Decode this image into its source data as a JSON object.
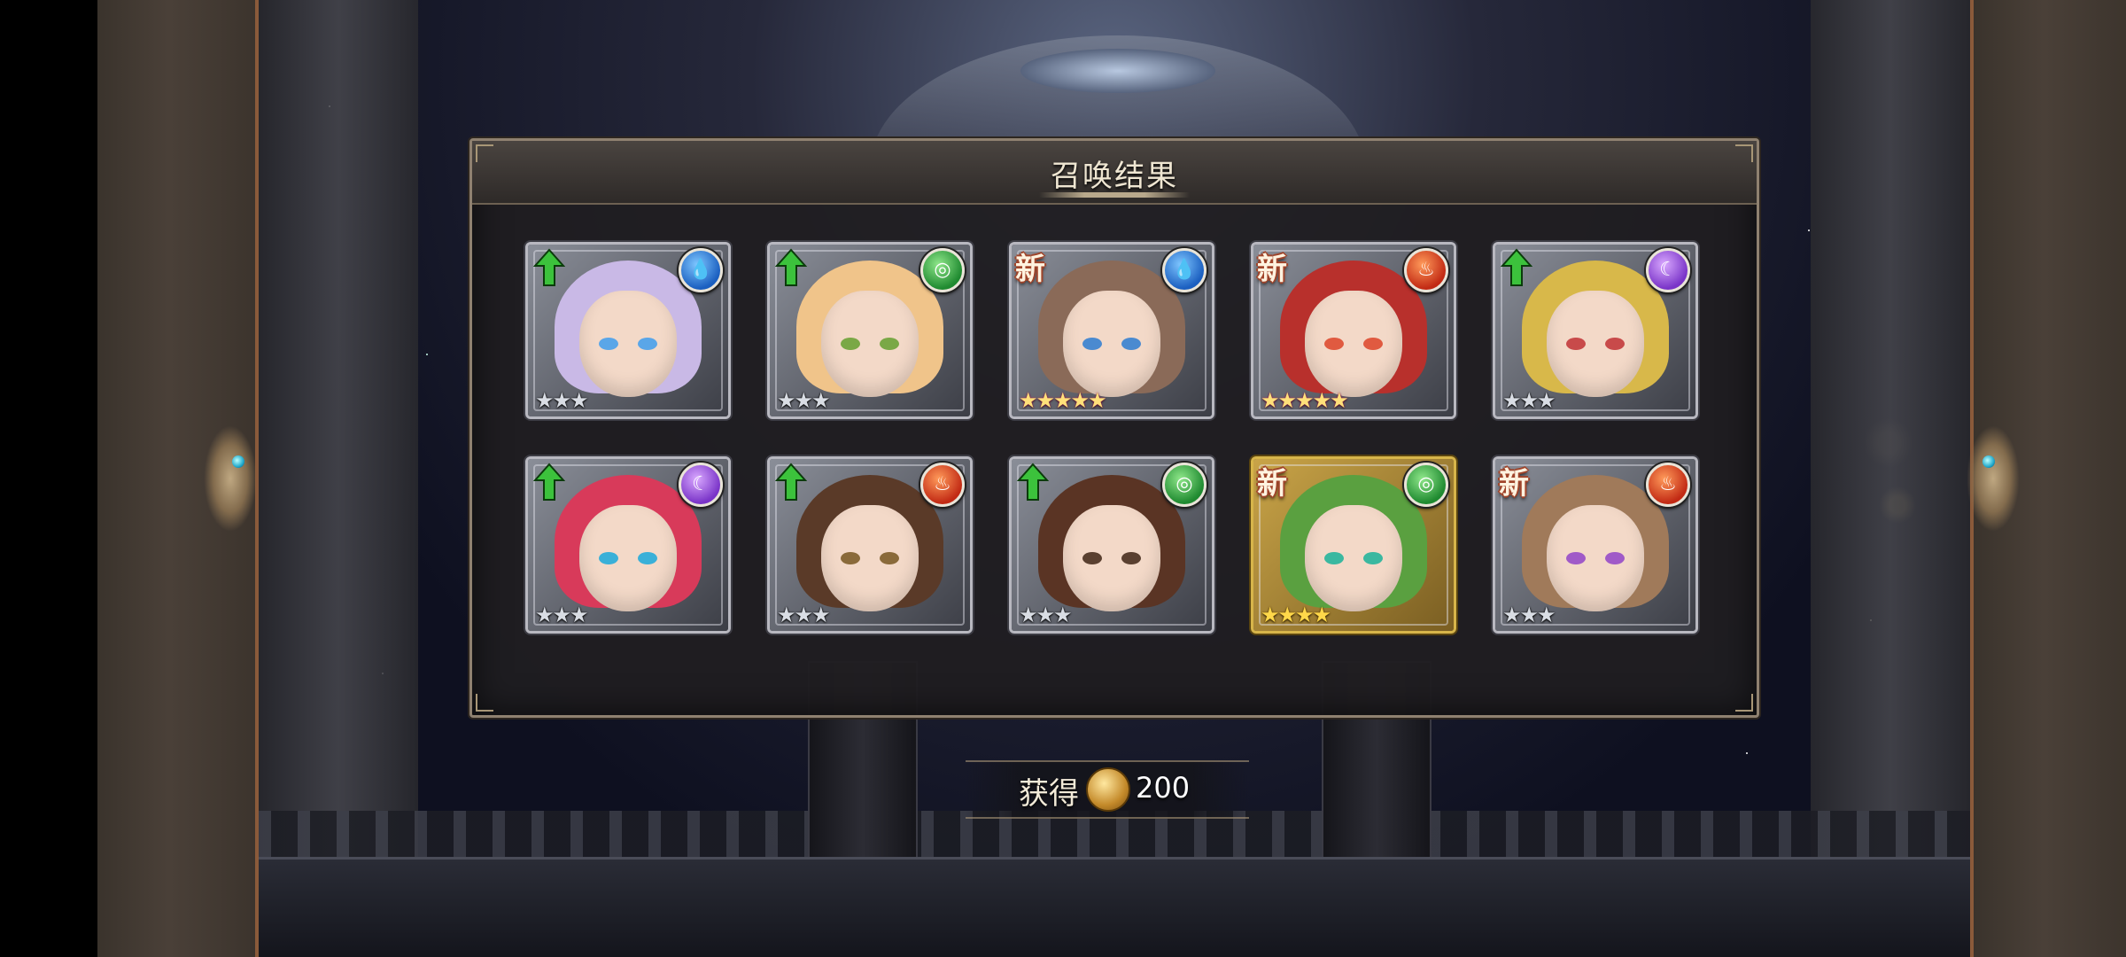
{
  "dialog": {
    "title": "召唤结果"
  },
  "cards": [
    {
      "badge": "up",
      "element": "water",
      "star_tier": "silver",
      "stars": "★★★",
      "hair": "#c9b9e6",
      "eye": "#5aa6e8"
    },
    {
      "badge": "up",
      "element": "wind",
      "star_tier": "silver",
      "stars": "★★★",
      "hair": "#f0c48a",
      "eye": "#7aa846"
    },
    {
      "badge": "new",
      "badge_text": "新",
      "element": "water",
      "star_tier": "rainbow",
      "stars": "★★★★★",
      "hair": "#8a6a58",
      "eye": "#4a8ad0"
    },
    {
      "badge": "new",
      "badge_text": "新",
      "element": "fire",
      "star_tier": "rainbow",
      "stars": "★★★★★",
      "hair": "#b8302c",
      "eye": "#e05a40"
    },
    {
      "badge": "up",
      "element": "dark",
      "star_tier": "silver",
      "stars": "★★★",
      "hair": "#d8b84a",
      "eye": "#c84a4a"
    },
    {
      "badge": "up",
      "element": "dark",
      "star_tier": "silver",
      "stars": "★★★",
      "hair": "#d83a5a",
      "eye": "#3ab0d8"
    },
    {
      "badge": "up",
      "element": "fire",
      "star_tier": "silver",
      "stars": "★★★",
      "hair": "#5a3a28",
      "eye": "#8a6a3a"
    },
    {
      "badge": "up",
      "element": "wind",
      "star_tier": "silver",
      "stars": "★★★",
      "hair": "#5a3424",
      "eye": "#5a4030"
    },
    {
      "badge": "new",
      "badge_text": "新",
      "element": "wind",
      "star_tier": "gold",
      "stars": "★★★★",
      "hair": "#5aa040",
      "eye": "#3ab8a0"
    },
    {
      "badge": "new",
      "badge_text": "新",
      "element": "fire",
      "star_tier": "silver",
      "stars": "★★★",
      "hair": "#a07a5a",
      "eye": "#a05ac8"
    }
  ],
  "reward": {
    "label": "获得",
    "icon": "gold-coin-icon",
    "amount": "200"
  },
  "colors": {
    "water": "#1b5fc0",
    "wind": "#1f8a30",
    "fire": "#c22a14",
    "dark": "#7a34c8",
    "up_arrow": "#3cc23c",
    "new_badge": "#a0442a"
  }
}
